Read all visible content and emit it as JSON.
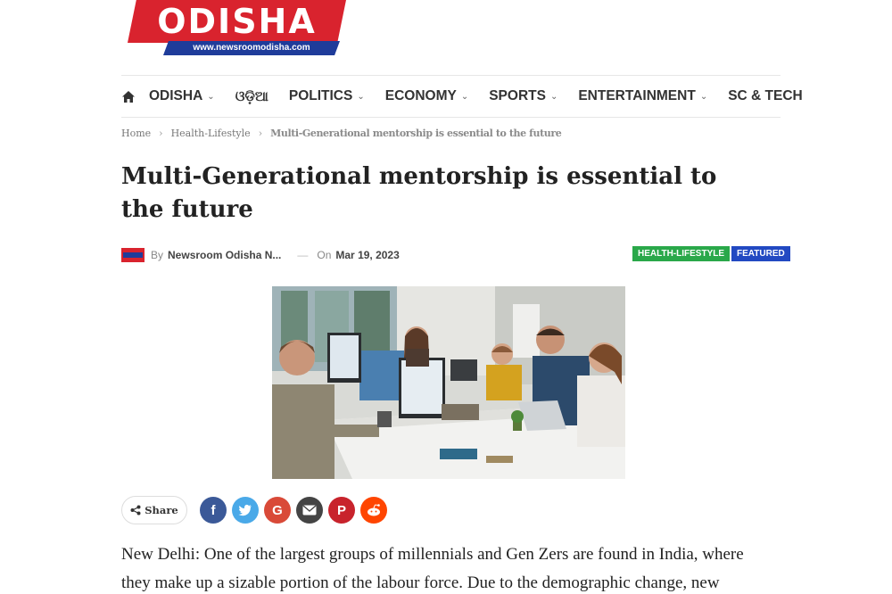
{
  "logo": {
    "text": "ODISHA",
    "url": "www.newsroomodisha.com"
  },
  "nav": {
    "items": [
      {
        "label": "ODISHA",
        "dropdown": true
      },
      {
        "label": "ଓଡ଼ିଆ",
        "dropdown": false
      },
      {
        "label": "POLITICS",
        "dropdown": true
      },
      {
        "label": "ECONOMY",
        "dropdown": true
      },
      {
        "label": "SPORTS",
        "dropdown": true
      },
      {
        "label": "ENTERTAINMENT",
        "dropdown": true
      },
      {
        "label": "SC & TECH",
        "dropdown": false
      }
    ]
  },
  "breadcrumb": {
    "home": "Home",
    "category": "Health-Lifestyle",
    "current": "Multi-Generational mentorship is essential to the future"
  },
  "article": {
    "title": "Multi-Generational mentorship is essential to the future",
    "by_label": "By",
    "author": "Newsroom Odisha N...",
    "on_label": "On",
    "date": "Mar 19, 2023",
    "tags": [
      "HEALTH-LIFESTYLE",
      "FEATURED"
    ],
    "body_line1": "New Delhi: One of the largest groups of millennials and Gen Zers are found in India, where",
    "body_line2": "they make up a sizable portion of the labour force. Due to the demographic change, new"
  },
  "share": {
    "label": "Share",
    "icons": [
      {
        "name": "facebook-icon",
        "color": "#3b5998",
        "glyph": "f"
      },
      {
        "name": "twitter-icon",
        "color": "#4aa9e8",
        "glyph": "t"
      },
      {
        "name": "google-icon",
        "color": "#d94a38",
        "glyph": "G"
      },
      {
        "name": "email-icon",
        "color": "#444444",
        "glyph": "✉"
      },
      {
        "name": "pinterest-icon",
        "color": "#c8232c",
        "glyph": "P"
      },
      {
        "name": "reddit-icon",
        "color": "#ff4500",
        "glyph": "r"
      }
    ]
  },
  "colors": {
    "brand_red": "#d9232e",
    "brand_blue": "#1f3c9a"
  }
}
